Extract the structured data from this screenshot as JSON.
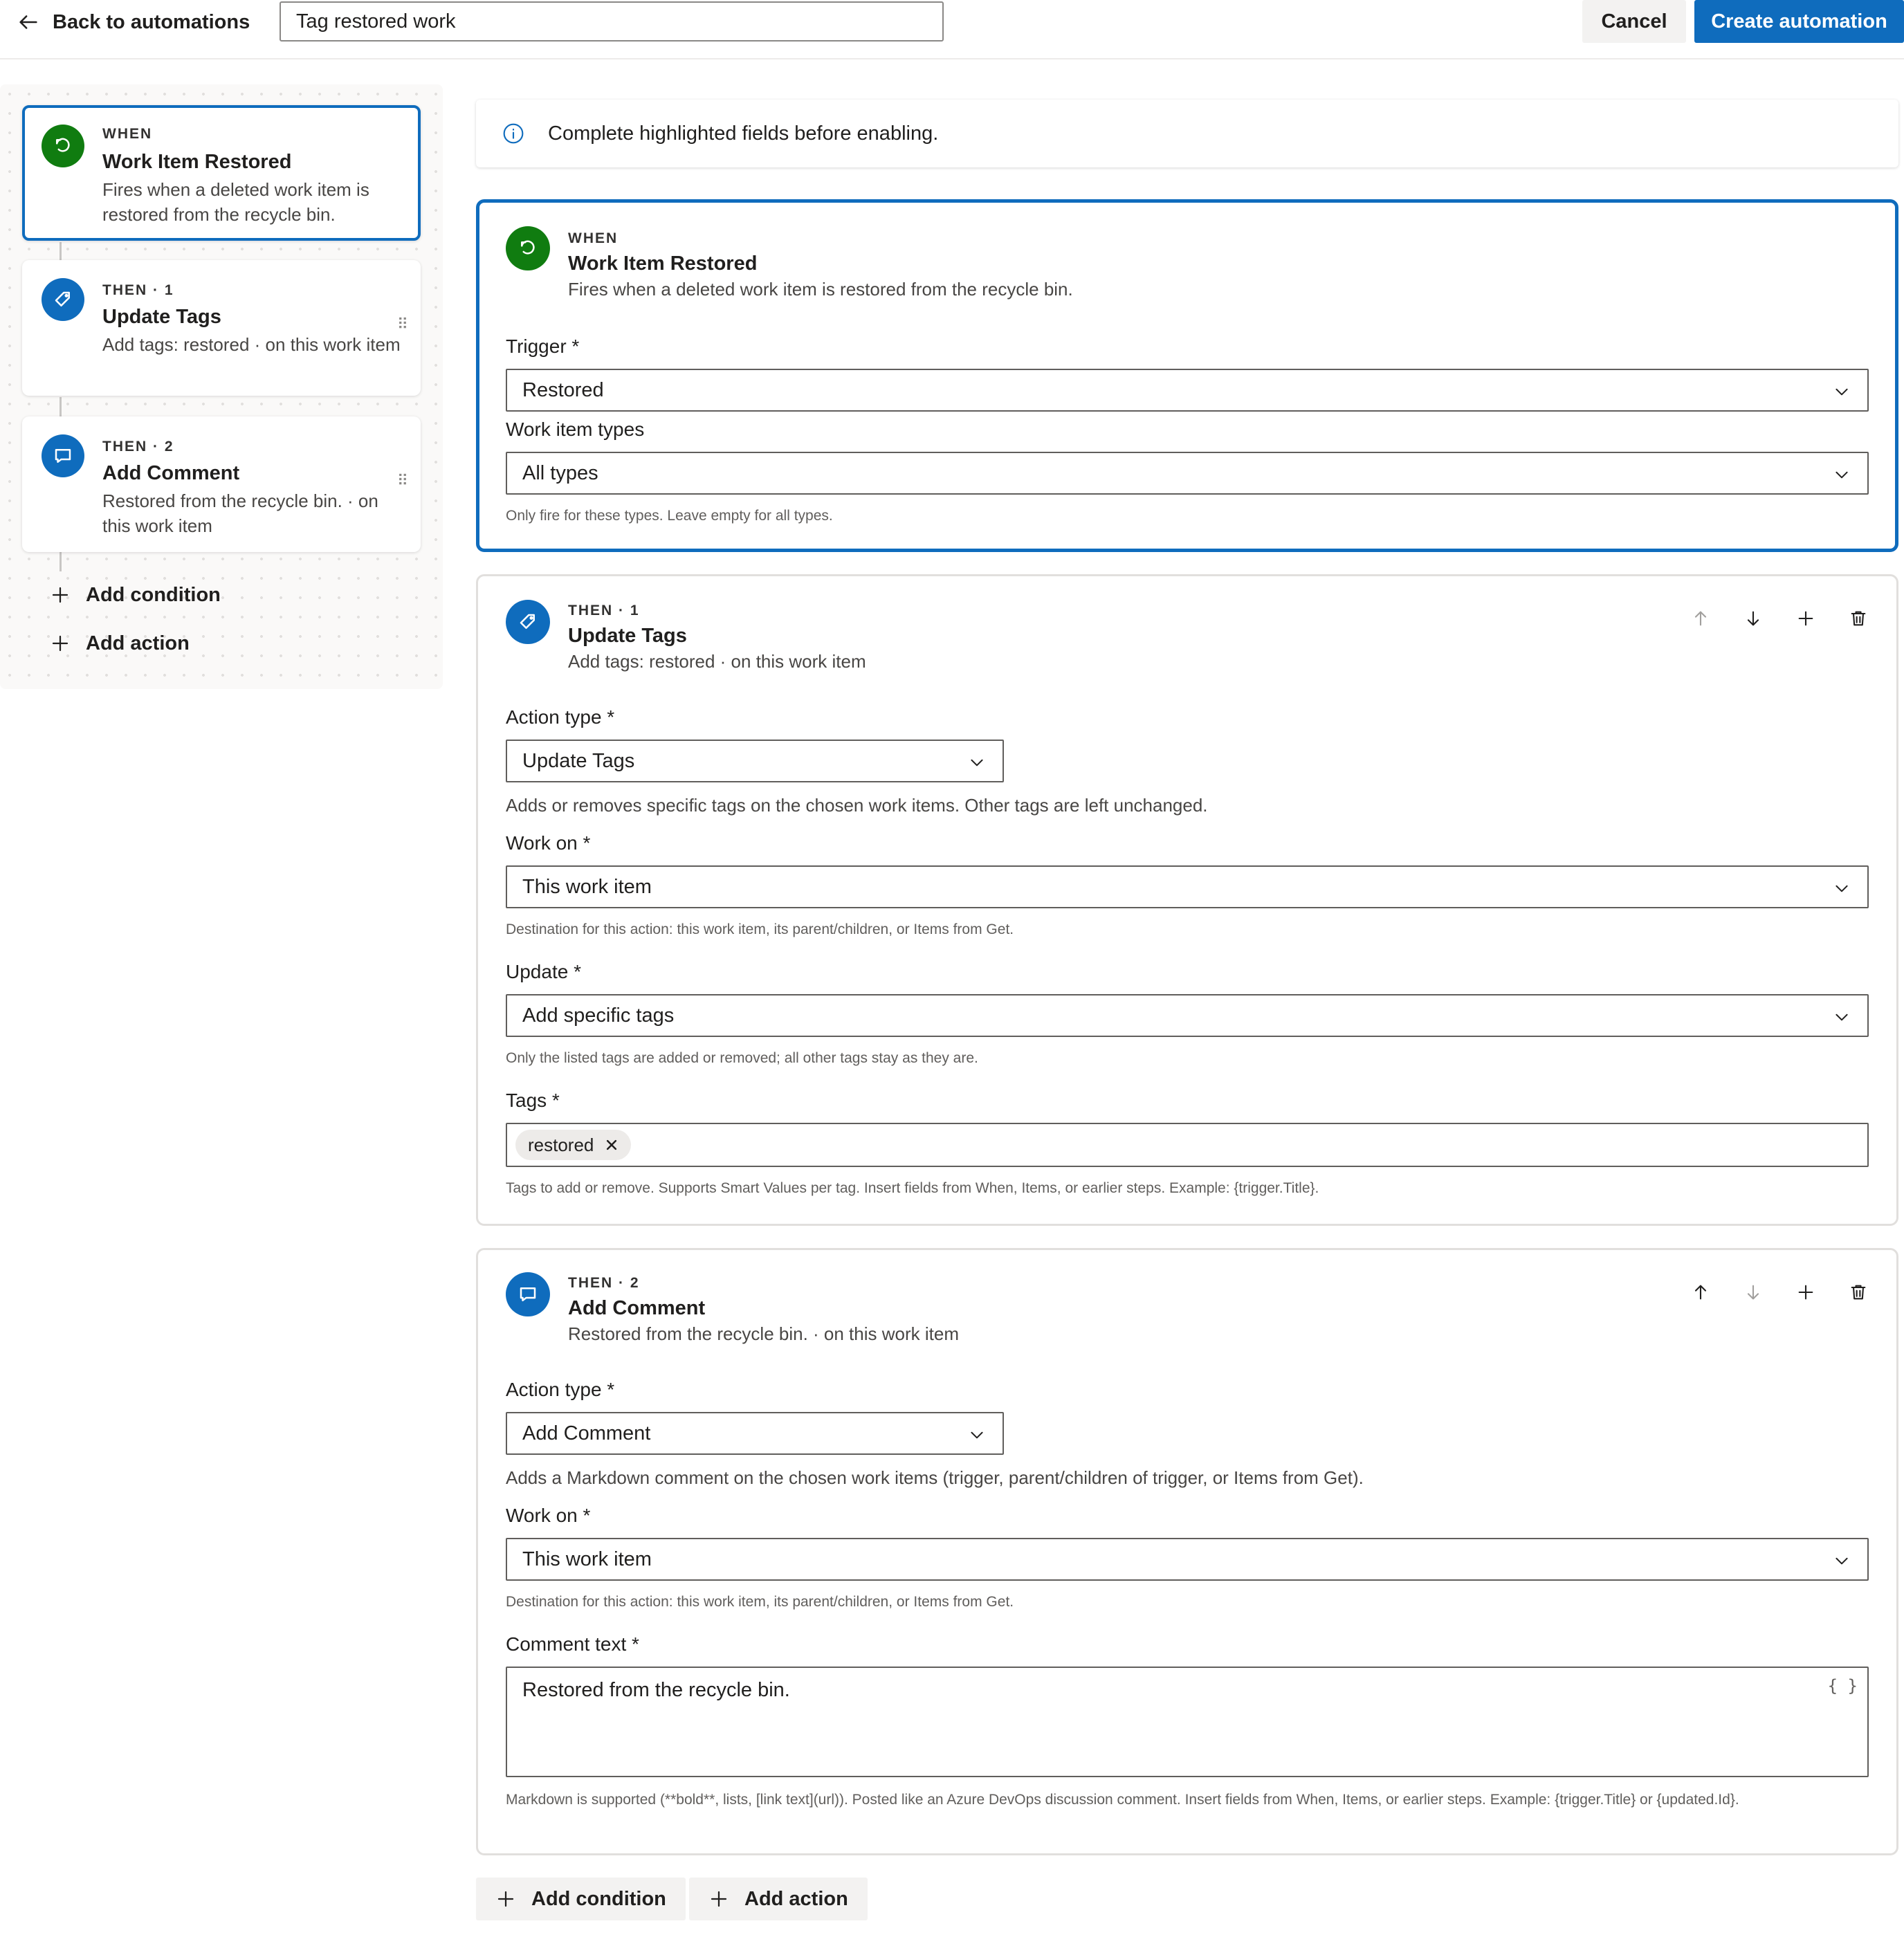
{
  "header": {
    "back_label": "Back to automations",
    "name_value": "Tag restored work",
    "cancel_label": "Cancel",
    "create_label": "Create automation"
  },
  "sidebar": {
    "when": {
      "kicker": "WHEN",
      "title": "Work Item Restored",
      "desc": "Fires when a deleted work item is restored from the recycle bin."
    },
    "actions": [
      {
        "kicker": "THEN · 1",
        "title": "Update Tags",
        "desc": "Add tags: restored · on this work item"
      },
      {
        "kicker": "THEN · 2",
        "title": "Add Comment",
        "desc": "Restored from the recycle bin. · on this work item"
      }
    ],
    "add_condition_label": "Add condition",
    "add_action_label": "Add action"
  },
  "info": {
    "message": "Complete highlighted fields before enabling."
  },
  "when_card": {
    "kicker": "WHEN",
    "title": "Work Item Restored",
    "subtitle": "Fires when a deleted work item is restored from the recycle bin.",
    "trigger_label": "Trigger *",
    "trigger_value": "Restored",
    "types_label": "Work item types",
    "types_value": "All types",
    "types_hint": "Only fire for these types. Leave empty for all types."
  },
  "action1": {
    "kicker": "THEN · 1",
    "title": "Update Tags",
    "subtitle": "Add tags: restored · on this work item",
    "action_type_label": "Action type *",
    "action_type_value": "Update Tags",
    "action_type_help": "Adds or removes specific tags on the chosen work items. Other tags are left unchanged.",
    "work_on_label": "Work on *",
    "work_on_value": "This work item",
    "work_on_hint": "Destination for this action: this work item, its parent/children, or Items from Get.",
    "update_label": "Update *",
    "update_value": "Add specific tags",
    "update_hint": "Only the listed tags are added or removed; all other tags stay as they are.",
    "tags_label": "Tags *",
    "tags": [
      "restored"
    ],
    "tags_hint": "Tags to add or remove. Supports Smart Values per tag. Insert fields from When, Items, or earlier steps. Example: {trigger.Title}."
  },
  "action2": {
    "kicker": "THEN · 2",
    "title": "Add Comment",
    "subtitle": "Restored from the recycle bin. · on this work item",
    "action_type_label": "Action type *",
    "action_type_value": "Add Comment",
    "action_type_help": "Adds a Markdown comment on the chosen work items (trigger, parent/children of trigger, or Items from Get).",
    "work_on_label": "Work on *",
    "work_on_value": "This work item",
    "work_on_hint": "Destination for this action: this work item, its parent/children, or Items from Get.",
    "comment_label": "Comment text *",
    "comment_value": "Restored from the recycle bin.",
    "smart_value_glyph": "{ }",
    "comment_hint": "Markdown is supported (**bold**, lists, [link text](url)). Posted like an Azure DevOps discussion comment. Insert fields from When, Items, or earlier steps. Example: {trigger.Title} or {updated.Id}."
  },
  "footer": {
    "add_condition_label": "Add condition",
    "add_action_label": "Add action"
  },
  "colors": {
    "accent": "#0f6cbd",
    "trigger_green": "#107c10",
    "border": "#e1dfdd"
  }
}
